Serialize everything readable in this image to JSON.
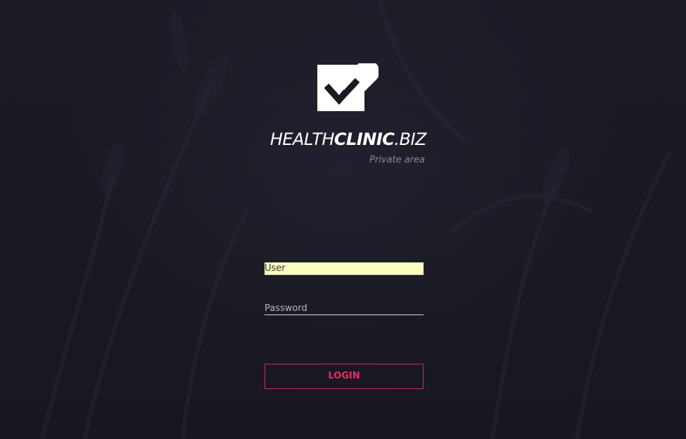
{
  "brand": {
    "logo_icon": "heart-check-icon",
    "name_light": "HEALTH",
    "name_bold": "CLINIC",
    "name_suffix": ".BIZ",
    "subtitle": "Private area"
  },
  "form": {
    "user_placeholder": "User",
    "password_placeholder": "Password",
    "login_label": "LOGIN"
  },
  "colors": {
    "background": "#1a1a24",
    "accent": "#e0245e",
    "autofill": "#faffbd",
    "text": "#ffffff"
  }
}
